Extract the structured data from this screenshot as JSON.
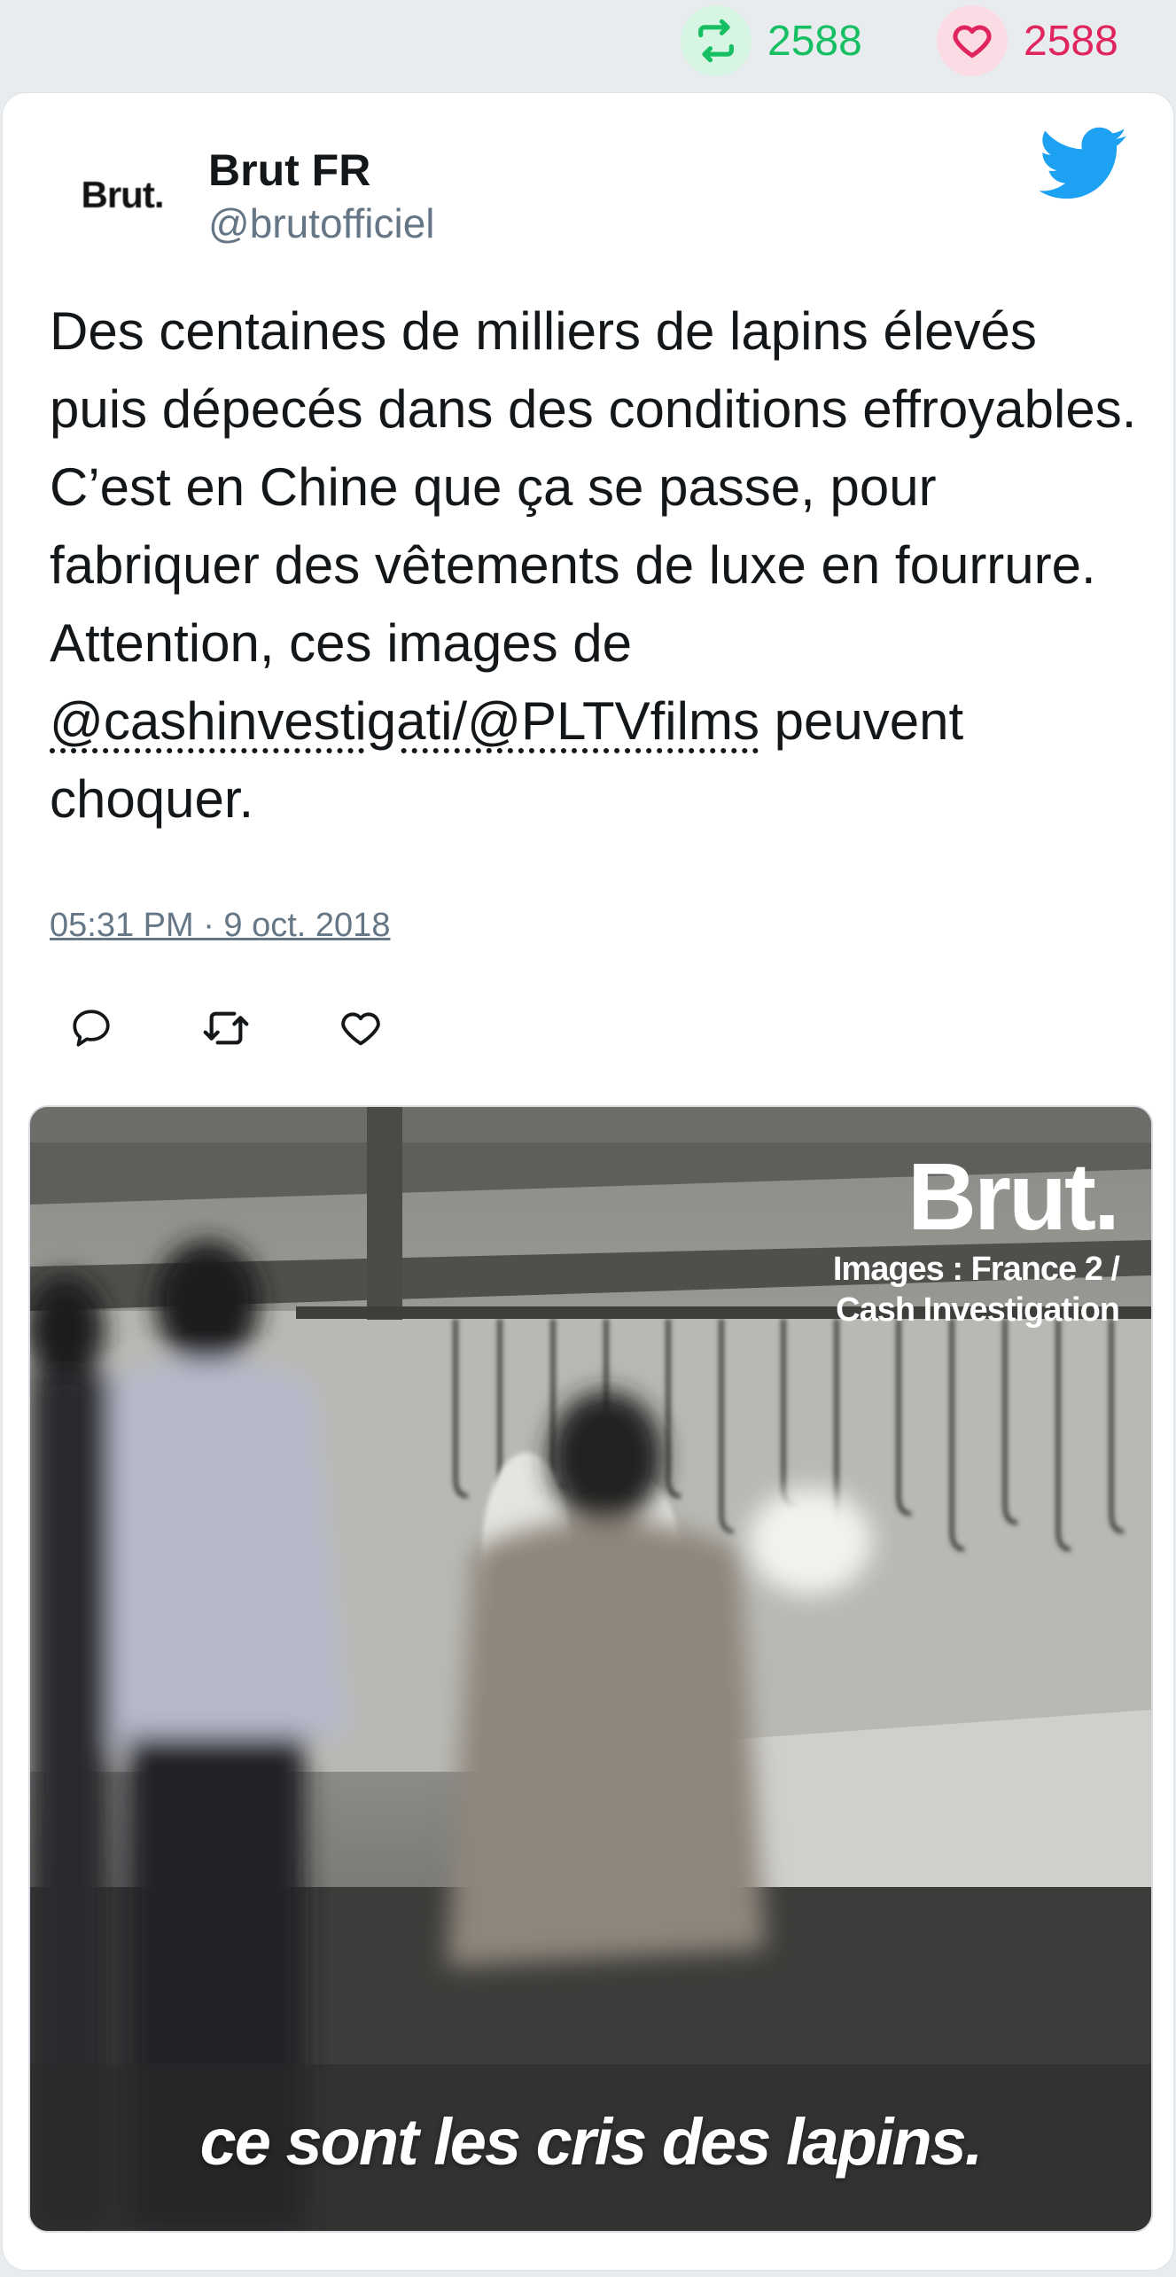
{
  "stats": {
    "retweets": "2588",
    "likes": "2588",
    "retweet_icon": "retweet-icon",
    "like_icon": "heart-icon",
    "retweet_color": "#17bf63",
    "like_color": "#e0245e"
  },
  "tweet": {
    "avatar_text": "Brut.",
    "name": "Brut FR",
    "handle": "@brutofficiel",
    "text_before": "Des centaines de milliers de lapins élevés puis dépecés dans des conditions effroyables. C’est en Chine que ça se passe, pour fabriquer des vêtements de luxe en fourrure. Attention, ces images de ",
    "mention": "@cashinvestigati/@PLTVfilms",
    "text_after": " peuvent choquer.",
    "timestamp": "05:31 PM · 9 oct. 2018",
    "brand_icon": "twitter-bird-icon",
    "brand_color": "#1da1f2"
  },
  "actions": [
    "reply-icon",
    "retweet-icon",
    "like-icon"
  ],
  "media": {
    "brand": "Brut.",
    "credit_line1": "Images : France 2 /",
    "credit_line2": "Cash Investigation",
    "subtitle": "ce sont les cris des lapins."
  }
}
